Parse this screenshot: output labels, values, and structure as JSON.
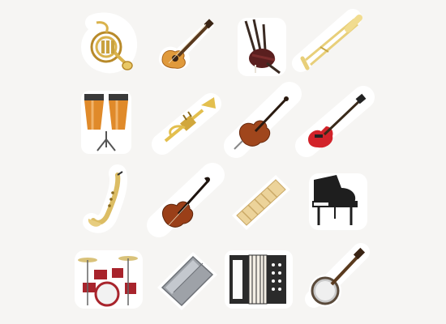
{
  "instruments": [
    {
      "icon": "french-horn-icon",
      "color": "#d9b24c"
    },
    {
      "icon": "acoustic-guitar-icon",
      "color": "#e09a3c"
    },
    {
      "icon": "bagpipes-icon",
      "color": "#5a1f1f"
    },
    {
      "icon": "trombone-icon",
      "color": "#e8cf7a"
    },
    {
      "icon": "conga-drums-icon",
      "color": "#e08a2a"
    },
    {
      "icon": "trumpet-icon",
      "color": "#e3bf4e"
    },
    {
      "icon": "cello-icon",
      "color": "#a0461c"
    },
    {
      "icon": "electric-bass-icon",
      "color": "#d2232a"
    },
    {
      "icon": "saxophone-icon",
      "color": "#dcbd64"
    },
    {
      "icon": "violin-icon",
      "color": "#9a3f18"
    },
    {
      "icon": "xylophone-icon",
      "color": "#ecd39a"
    },
    {
      "icon": "grand-piano-icon",
      "color": "#1e1e1e"
    },
    {
      "icon": "drum-kit-icon",
      "color": "#a8242c"
    },
    {
      "icon": "harmonica-icon",
      "color": "#9ea2a8"
    },
    {
      "icon": "accordion-icon",
      "color": "#2b2b2b"
    },
    {
      "icon": "banjo-icon",
      "color": "#c9c9c9"
    }
  ]
}
